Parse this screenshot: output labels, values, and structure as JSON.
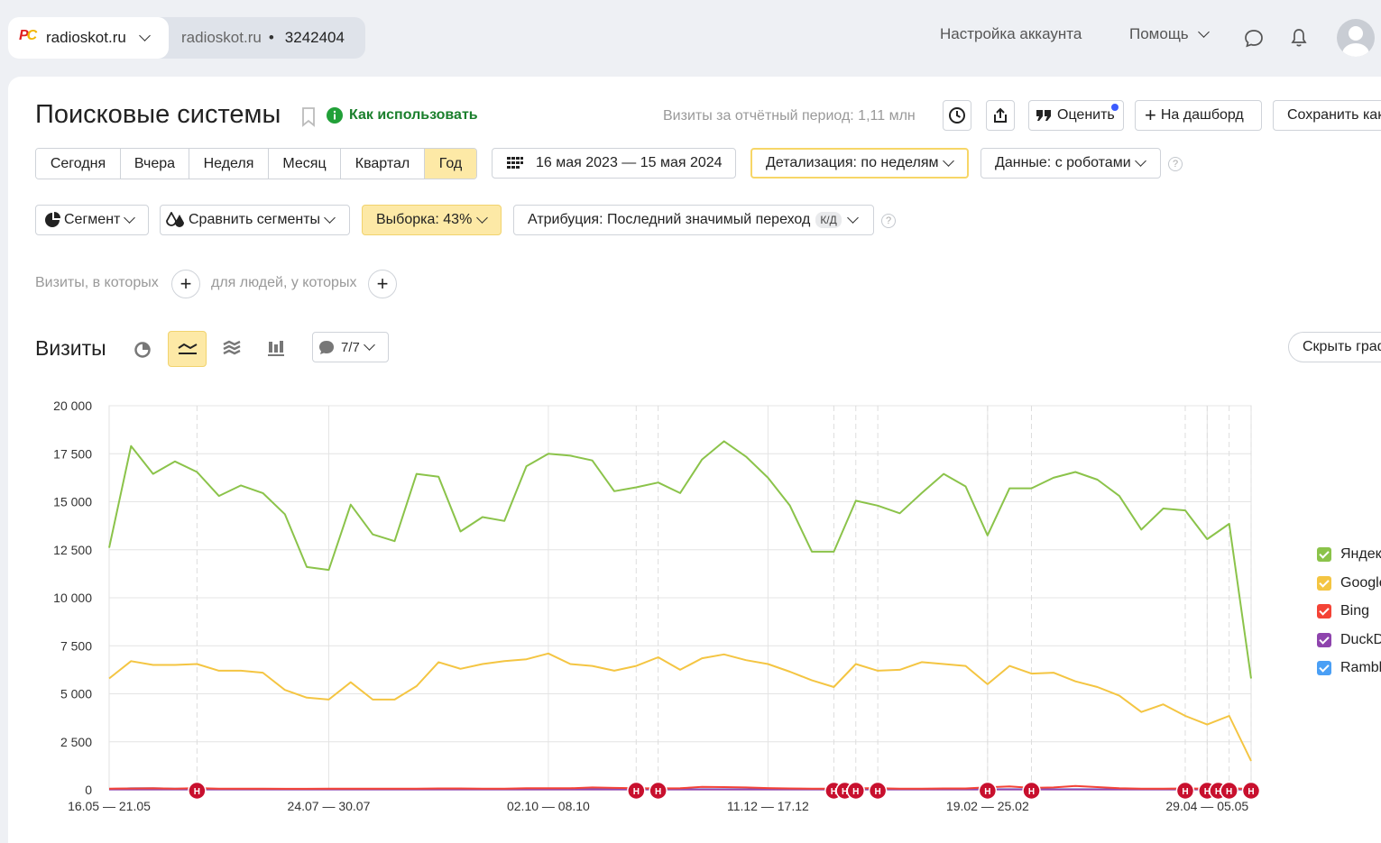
{
  "header": {
    "site_name": "radioskot.ru",
    "counter_site": "radioskot.ru",
    "counter_sep": "•",
    "counter_id": "3242404",
    "account_settings": "Настройка аккаунта",
    "help": "Помощь"
  },
  "report": {
    "title": "Поисковые системы",
    "how_to_use": "Как использовать",
    "visits_period": "Визиты за отчётный период: 1,11 млн",
    "rate_label": "Оценить",
    "dashboard_label": "На дашборд",
    "save_label": "Сохранить как"
  },
  "periods": [
    "Сегодня",
    "Вчера",
    "Неделя",
    "Месяц",
    "Квартал",
    "Год"
  ],
  "active_period": "Год",
  "date_range": "16 мая 2023 — 15 мая 2024",
  "detail": "Детализация: по неделям",
  "data_mode": "Данные: с роботами",
  "segment": "Сегмент",
  "compare": "Сравнить сегменты",
  "sample": "Выборка: 43%",
  "attribution": "Атрибуция: Последний значимый переход",
  "attribution_badge": "К/Д",
  "filter": {
    "visits_where": "Визиты, в которых",
    "people_where": "для людей, у которых"
  },
  "chart_section": {
    "title": "Визиты",
    "annotations": "7/7",
    "hide_graph": "Скрыть график"
  },
  "legend": [
    {
      "name": "Яндекс",
      "color": "#8bc34a"
    },
    {
      "name": "Google",
      "color": "#f4c542"
    },
    {
      "name": "Bing",
      "color": "#f44336"
    },
    {
      "name": "DuckDuckGo",
      "color": "#8e44ad"
    },
    {
      "name": "Rambler",
      "color": "#4a9ff5"
    }
  ],
  "chart_data": {
    "type": "line",
    "ylim": [
      0,
      20000
    ],
    "ytick_labels": [
      "0",
      "2 500",
      "5 000",
      "7 500",
      "10 000",
      "12 500",
      "15 000",
      "17 500",
      "20 000"
    ],
    "xtick_labels": [
      "16.05 — 21.05",
      "24.07 — 30.07",
      "02.10 — 08.10",
      "11.12 — 17.12",
      "19.02 — 25.02",
      "29.04 — 05.05"
    ],
    "grid": true,
    "legend_position": "right",
    "series": [
      {
        "name": "Яндекс",
        "color": "#8bc34a",
        "values": [
          12600,
          17900,
          16450,
          17100,
          16550,
          15300,
          15850,
          15450,
          14350,
          11600,
          11450,
          14850,
          13300,
          12950,
          16450,
          16300,
          13450,
          14200,
          14000,
          16850,
          17500,
          17400,
          17150,
          15550,
          15750,
          16000,
          15450,
          17200,
          18150,
          17350,
          16250,
          14800,
          12400,
          12400,
          15050,
          14800,
          14400,
          15450,
          16450,
          15800,
          13250,
          15700,
          15700,
          16250,
          16550,
          16150,
          15300,
          13550,
          14650,
          14550,
          13050,
          13850,
          5800
        ]
      },
      {
        "name": "Google",
        "color": "#f4c542",
        "values": [
          5800,
          6700,
          6500,
          6500,
          6550,
          6200,
          6200,
          6100,
          5200,
          4800,
          4700,
          5600,
          4700,
          4700,
          5400,
          6650,
          6300,
          6550,
          6700,
          6800,
          7100,
          6550,
          6450,
          6200,
          6450,
          6900,
          6250,
          6850,
          7050,
          6750,
          6550,
          6150,
          5700,
          5350,
          6550,
          6200,
          6250,
          6650,
          6550,
          6450,
          5500,
          6450,
          6050,
          6100,
          5650,
          5350,
          4900,
          4050,
          4450,
          3850,
          3400,
          3850,
          1500
        ]
      },
      {
        "name": "Bing",
        "color": "#f44336",
        "values": [
          60,
          70,
          80,
          60,
          90,
          60,
          60,
          60,
          50,
          50,
          60,
          60,
          60,
          60,
          60,
          70,
          70,
          60,
          60,
          80,
          80,
          80,
          120,
          100,
          80,
          70,
          80,
          150,
          140,
          120,
          90,
          70,
          60,
          60,
          80,
          80,
          60,
          60,
          70,
          70,
          130,
          180,
          100,
          120,
          200,
          140,
          80,
          60,
          60,
          70,
          60,
          80,
          40
        ]
      },
      {
        "name": "DuckDuckGo",
        "color": "#8e44ad",
        "values": [
          20,
          20,
          20,
          20,
          20,
          20,
          20,
          20,
          20,
          20,
          20,
          20,
          20,
          20,
          20,
          20,
          20,
          20,
          20,
          20,
          20,
          20,
          20,
          20,
          20,
          20,
          20,
          20,
          20,
          20,
          20,
          20,
          20,
          20,
          20,
          20,
          20,
          20,
          20,
          20,
          20,
          20,
          20,
          20,
          20,
          20,
          20,
          20,
          20,
          20,
          20,
          20,
          10
        ]
      },
      {
        "name": "Rambler",
        "color": "#4a9ff5",
        "values": [
          30,
          80,
          80,
          60,
          50,
          40,
          40,
          40,
          30,
          30,
          30,
          30,
          30,
          30,
          30,
          30,
          30,
          30,
          30,
          30,
          30,
          30,
          30,
          30,
          30,
          30,
          30,
          30,
          30,
          30,
          30,
          30,
          30,
          30,
          30,
          30,
          30,
          30,
          30,
          30,
          30,
          30,
          30,
          30,
          30,
          30,
          30,
          30,
          30,
          30,
          30,
          30,
          20
        ]
      }
    ],
    "annotation_marker": "Н"
  }
}
